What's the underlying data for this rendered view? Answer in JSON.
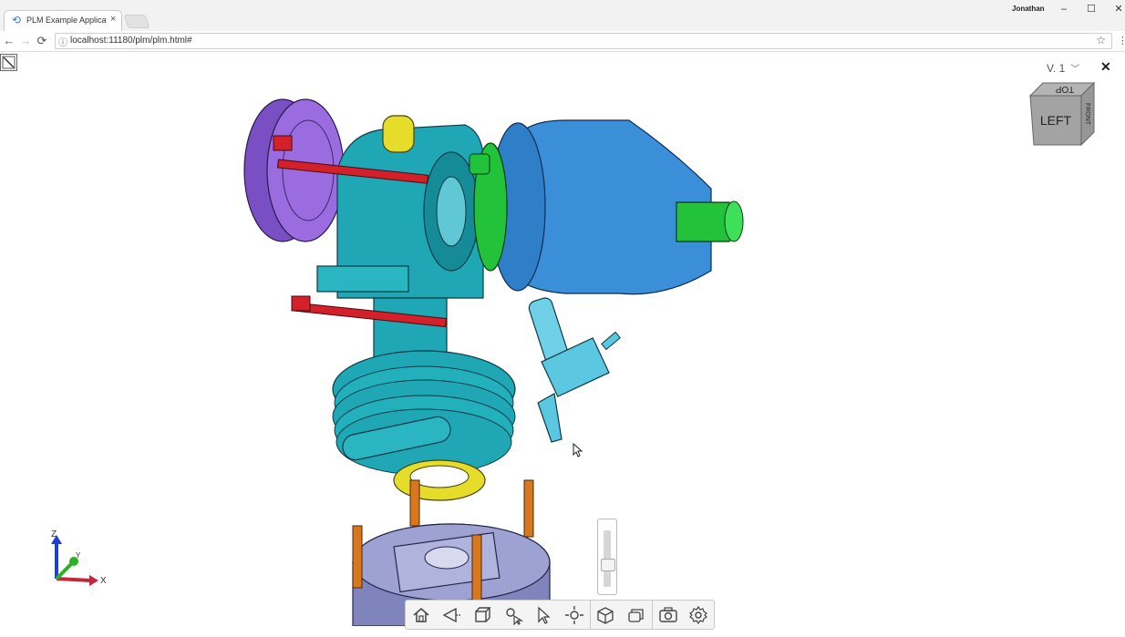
{
  "browser": {
    "tab_title": "PLM Example Application",
    "tab_close": "×",
    "user_name": "Jonathan",
    "url": "localhost:11180/plm/plm.html#",
    "window_controls": {
      "minimize": "–",
      "maximize": "☐",
      "close": "✕"
    },
    "nav": {
      "back": "←",
      "forward": "→",
      "reload": "⟳"
    }
  },
  "viewer": {
    "version_label": "V. 1",
    "close_label": "✕",
    "navcube": {
      "front_face": "LEFT",
      "top_face": "TOP",
      "right_face": "FRONT"
    },
    "axes": {
      "z": "Z",
      "y": "Y",
      "x": "X"
    },
    "toolbar_icons": [
      "home-icon",
      "orbit-icon",
      "view-cube-icon",
      "pan-icon",
      "select-icon",
      "explode-icon",
      "model-browser-icon",
      "layers-icon",
      "camera-icon",
      "settings-icon"
    ],
    "colors": {
      "teal": "#1fa7b6",
      "blue": "#3a8fd8",
      "green": "#22c33a",
      "purple": "#8a5bd0",
      "red": "#d4202a",
      "yellow": "#e6dc2a",
      "orange": "#d9771e",
      "gray": "#8a8fc4"
    }
  }
}
